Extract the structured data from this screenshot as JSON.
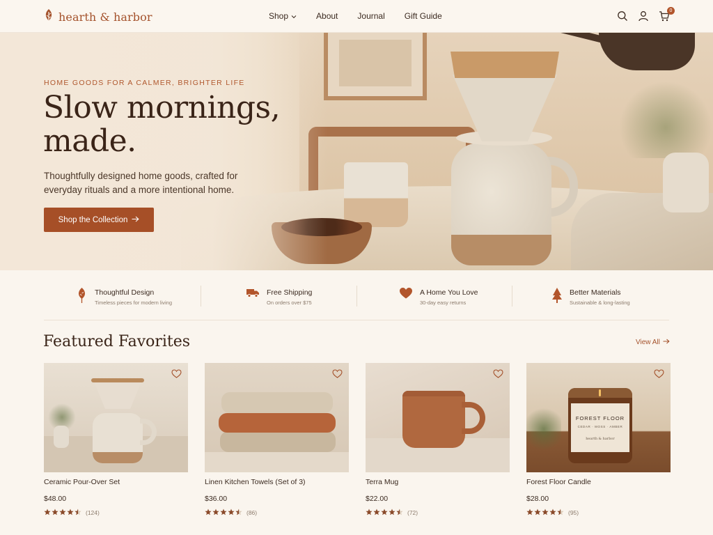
{
  "brand": {
    "name": "hearth & harbor"
  },
  "nav": {
    "items": [
      {
        "label": "Shop",
        "has_dropdown": true
      },
      {
        "label": "About",
        "has_dropdown": false
      },
      {
        "label": "Journal",
        "has_dropdown": false
      },
      {
        "label": "Gift Guide",
        "has_dropdown": false
      }
    ]
  },
  "header_icons": {
    "search": "search-icon",
    "account": "user-icon",
    "cart": "cart-icon",
    "cart_count": "0"
  },
  "hero": {
    "kicker": "HOME GOODS FOR A CALMER, BRIGHTER LIFE",
    "title": "Slow mornings, made.",
    "subtitle": "Thoughtfully designed home goods, crafted for everyday rituals and a more intentional home.",
    "cta_label": "Shop the Collection"
  },
  "features": [
    {
      "icon": "leaf-icon",
      "title": "Thoughtful Design",
      "subtitle": "Timeless pieces for modern living"
    },
    {
      "icon": "truck-icon",
      "title": "Free Shipping",
      "subtitle": "On orders over $75"
    },
    {
      "icon": "heart-icon",
      "title": "A Home You Love",
      "subtitle": "30-day easy returns"
    },
    {
      "icon": "tree-icon",
      "title": "Better Materials",
      "subtitle": "Sustainable & long-lasting"
    }
  ],
  "featured": {
    "title": "Featured Favorites",
    "view_all_label": "View All",
    "products": [
      {
        "name": "Ceramic Pour-Over Set",
        "price": "$48.00",
        "rating": 4.5,
        "reviews": "(124)"
      },
      {
        "name": "Linen Kitchen Towels (Set of 3)",
        "price": "$36.00",
        "rating": 4.5,
        "reviews": "(86)"
      },
      {
        "name": "Terra Mug",
        "price": "$22.00",
        "rating": 4.5,
        "reviews": "(72)"
      },
      {
        "name": "Forest Floor Candle",
        "price": "$28.00",
        "rating": 4.5,
        "reviews": "(95)",
        "label_text": "FOREST FLOOR",
        "label_sub": "CEDAR · MOSS · AMBER",
        "label_brand": "hearth & harbor"
      }
    ]
  },
  "colors": {
    "accent": "#a64f27",
    "brand": "#a4522c",
    "text": "#3b2a20",
    "background": "#faf5ee",
    "star": "#8a4a2a"
  }
}
